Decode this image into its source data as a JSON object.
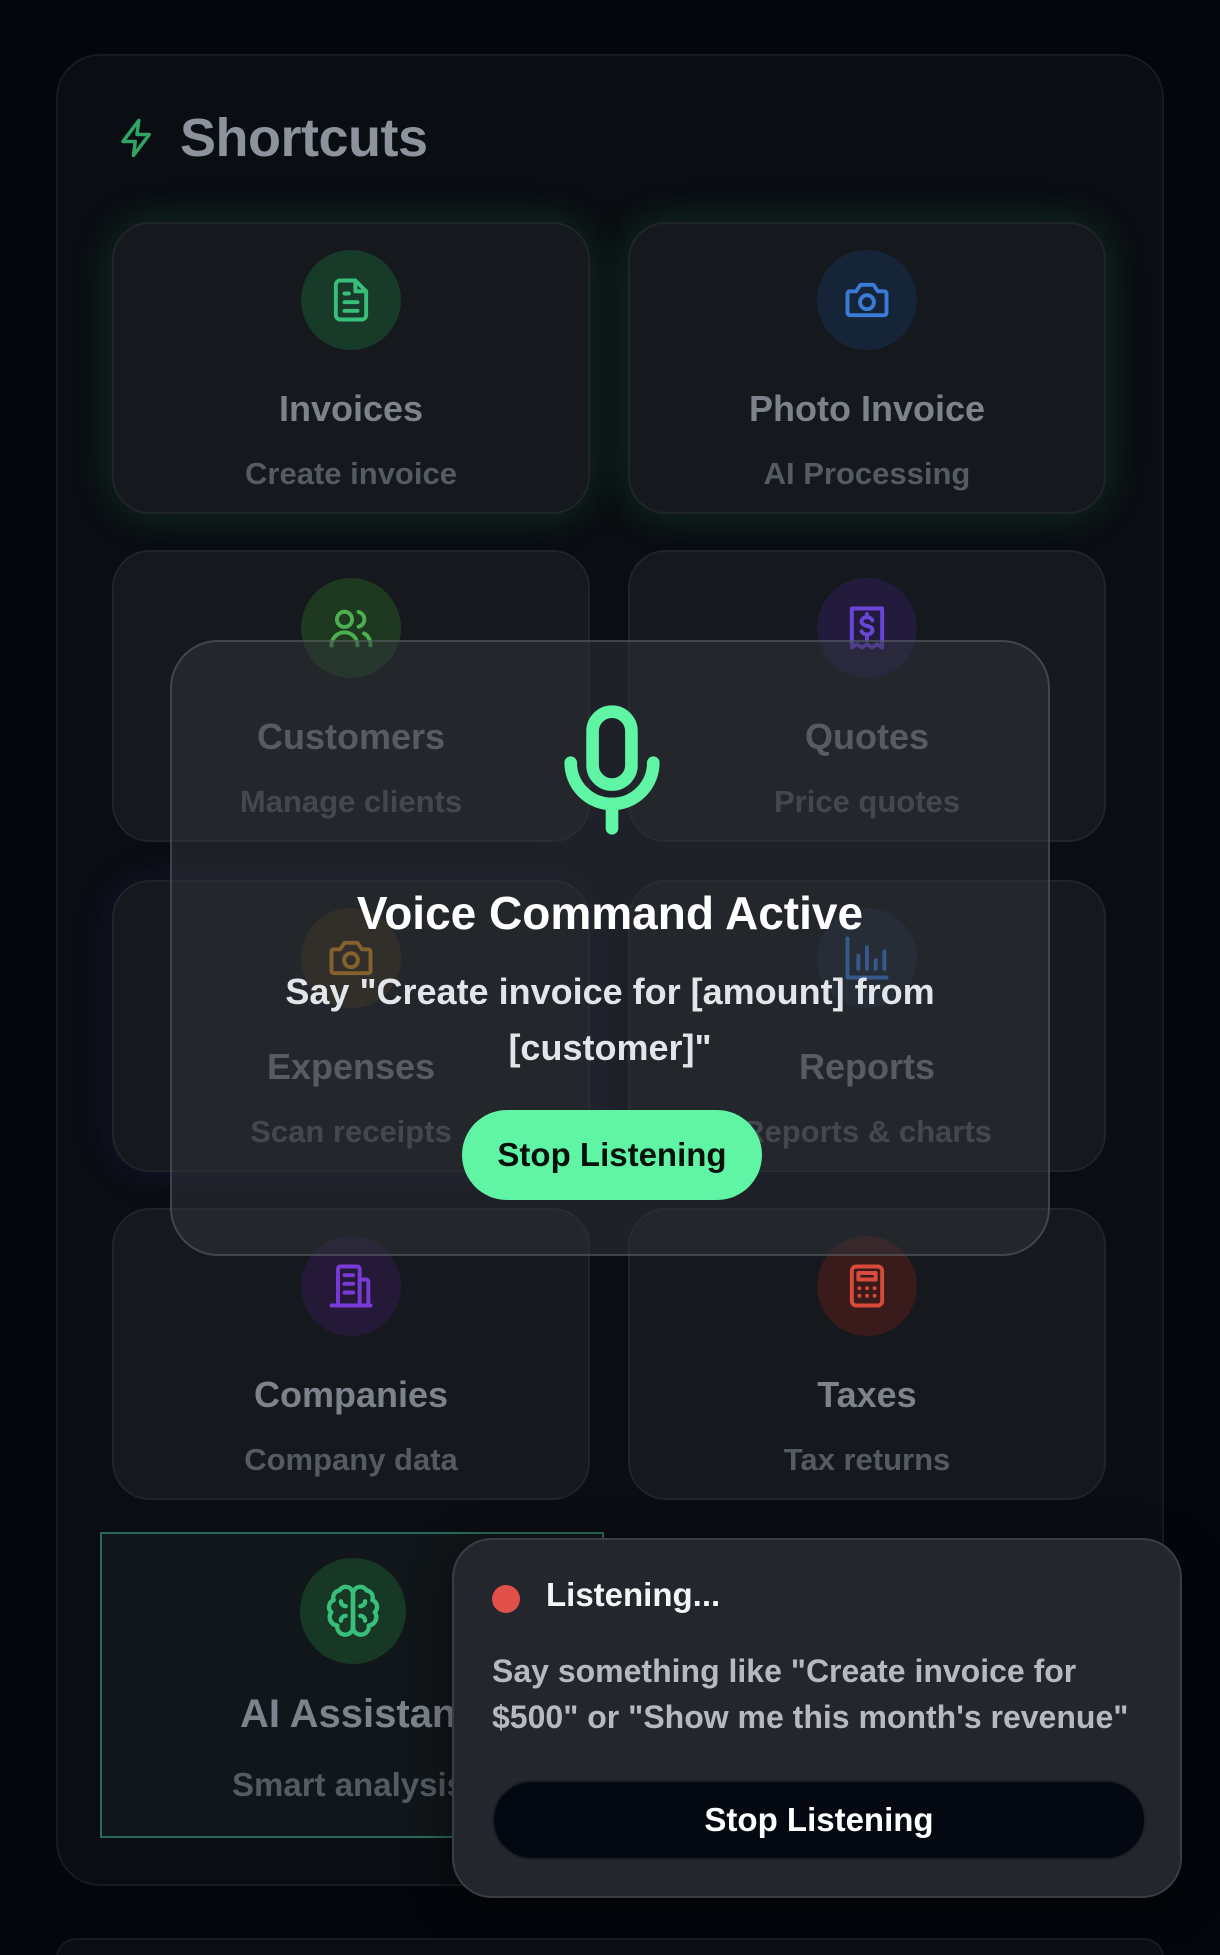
{
  "shortcuts": {
    "title": "Shortcuts",
    "title_icon": "lightning-bolt-icon",
    "cards": [
      {
        "title": "Invoices",
        "subtitle": "Create invoice",
        "icon": "document-icon",
        "color": "#38c07a"
      },
      {
        "title": "Photo Invoice",
        "subtitle": "AI Processing",
        "icon": "camera-icon",
        "color": "#3b7bd8"
      },
      {
        "title": "Customers",
        "subtitle": "Manage clients",
        "icon": "users-icon",
        "color": "#4caf50"
      },
      {
        "title": "Quotes",
        "subtitle": "Price quotes",
        "icon": "receipt-dollar-icon",
        "color": "#6a45d9"
      },
      {
        "title": "Expenses",
        "subtitle": "Scan receipts",
        "icon": "camera-icon",
        "color": "#d98c1f"
      },
      {
        "title": "Reports",
        "subtitle": "Reports & charts",
        "icon": "bar-chart-icon",
        "color": "#3b7bd8"
      },
      {
        "title": "Companies",
        "subtitle": "Company data",
        "icon": "building-icon",
        "color": "#7a3ad8"
      },
      {
        "title": "Taxes",
        "subtitle": "Tax returns",
        "icon": "calculator-icon",
        "color": "#d84a3a"
      },
      {
        "title": "AI Assistant",
        "subtitle": "Smart analysis",
        "icon": "brain-icon",
        "color": "#38c07a"
      }
    ]
  },
  "voice_modal": {
    "title": "Voice Command Active",
    "text": "Say \"Create invoice for [amount] from [customer]\"",
    "button_label": "Stop Listening",
    "icon": "microphone-icon",
    "accent": "#5ff5a5"
  },
  "listening_toast": {
    "title": "Listening...",
    "text": "Say something like \"Create invoice for $500\" or \"Show me this month's revenue\"",
    "button_label": "Stop Listening",
    "status_color": "#e2504a"
  }
}
